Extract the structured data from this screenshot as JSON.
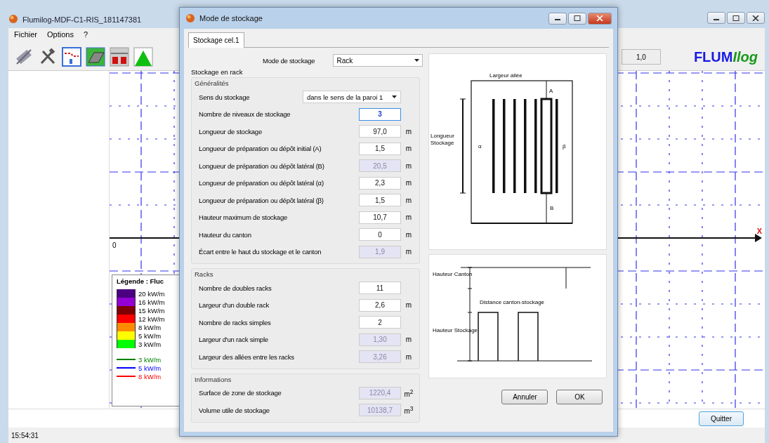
{
  "main_window": {
    "title": "Flumilog-MDF-C1-RIS_181147381",
    "menu": [
      "Fichier",
      "Options",
      "?"
    ],
    "zoom": {
      "value": "1,0"
    },
    "logo": {
      "part_1": "FLUM",
      "part_2": "Ilog"
    },
    "plot": {
      "origin_label": "0",
      "x_axis_label": "X"
    },
    "legend": {
      "title": "Légende : Fluc",
      "swatches": [
        {
          "label": "20 kW/m",
          "color": "#4b0082"
        },
        {
          "label": "16 kW/m",
          "color": "#9400d3"
        },
        {
          "label": "15 kW/m",
          "color": "#800000"
        },
        {
          "label": "12 kW/m",
          "color": "#ff0000"
        },
        {
          "label": "8 kW/m",
          "color": "#ff8c00"
        },
        {
          "label": "5 kW/m",
          "color": "#ffff00"
        },
        {
          "label": "3 kW/m",
          "color": "#00ff00"
        }
      ],
      "lines": [
        {
          "label": "3 kW/m",
          "color": "#008000"
        },
        {
          "label": "5 kW/m",
          "color": "#0000ff"
        },
        {
          "label": "8 kW/m",
          "color": "#ff0000"
        }
      ]
    },
    "quit_button": "Quitter",
    "status_bar": "15:54:31"
  },
  "dialog": {
    "title": "Mode de stockage",
    "tabs": [
      {
        "label": "Stockage cel.1",
        "selected": true
      }
    ],
    "mode": {
      "label": "Mode de stockage",
      "value": "Rack"
    },
    "outer_group": "Stockage en rack",
    "groups": [
      {
        "title": "Généralités",
        "fields": [
          {
            "kind": "select",
            "label": "Sens du stockage",
            "value": "dans le sens de la paroi 1"
          },
          {
            "kind": "input",
            "label": "Nombre de niveaux de stockage",
            "value": "3",
            "disabled": false,
            "focused": true
          },
          {
            "kind": "input",
            "label": "Longueur de stockage",
            "value": "97,0",
            "unit": "m",
            "disabled": false,
            "focused": false
          },
          {
            "kind": "input",
            "label": "Longueur de préparation ou dépôt initial (A)",
            "value": "1,5",
            "unit": "m",
            "disabled": false,
            "focused": false
          },
          {
            "kind": "input",
            "label": "Longueur de préparation ou dépôt latéral (B)",
            "value": "20,5",
            "unit": "m",
            "disabled": true,
            "focused": false
          },
          {
            "kind": "input",
            "label": "Longueur de préparation ou dépôt latéral (α)",
            "value": "2,3",
            "unit": "m",
            "disabled": false,
            "focused": false
          },
          {
            "kind": "input",
            "label": "Longueur de préparation ou dépôt latéral (β)",
            "value": "1,5",
            "unit": "m",
            "disabled": false,
            "focused": false
          },
          {
            "kind": "input",
            "label": "Hauteur maximum de stockage",
            "value": "10,7",
            "unit": "m",
            "disabled": false,
            "focused": false
          },
          {
            "kind": "input",
            "label": "Hauteur du canton",
            "value": "0",
            "unit": "m",
            "disabled": false,
            "focused": false
          },
          {
            "kind": "input",
            "label": "Écart entre le haut du stockage et le canton",
            "value": "1,9",
            "unit": "m",
            "disabled": true,
            "focused": false
          }
        ]
      },
      {
        "title": "Racks",
        "fields": [
          {
            "kind": "input",
            "label": "Nombre de doubles racks",
            "value": "11",
            "disabled": false,
            "focused": false
          },
          {
            "kind": "input",
            "label": "Largeur d'un double rack",
            "value": "2,6",
            "unit": "m",
            "disabled": false,
            "focused": false
          },
          {
            "kind": "input",
            "label": "Nombre de racks simples",
            "value": "2",
            "disabled": false,
            "focused": false
          },
          {
            "kind": "input",
            "label": "Largeur d'un rack simple",
            "value": "1,30",
            "unit": "m",
            "disabled": true,
            "focused": false
          },
          {
            "kind": "input",
            "label": "Largeur des allées entre les racks",
            "value": "3,26",
            "unit": "m",
            "disabled": true,
            "focused": false
          }
        ]
      },
      {
        "title": "Informations",
        "fields": [
          {
            "kind": "input",
            "label": "Surface de zone de stockage",
            "value": "1220,4",
            "unit": "m$^{2}$",
            "disabled": true,
            "focused": false
          },
          {
            "kind": "input",
            "label": "Volume utile de stockage",
            "value": "10138,7",
            "unit": "m$^{3}$",
            "disabled": true,
            "focused": false
          }
        ]
      }
    ],
    "plan_diagram": {
      "aisle_label": "Largeur allée",
      "a_label": "A",
      "b_label": "B",
      "alpha_label": "α",
      "beta_label": "β",
      "length_label": "Longueur Stockage"
    },
    "section_diagram": {
      "canton_label": "Hauteur Canton",
      "distance_label": "Distance canton-stockage",
      "storage_label": "Hauteur Stockage"
    },
    "buttons": [
      "Annuler",
      "OK"
    ]
  }
}
